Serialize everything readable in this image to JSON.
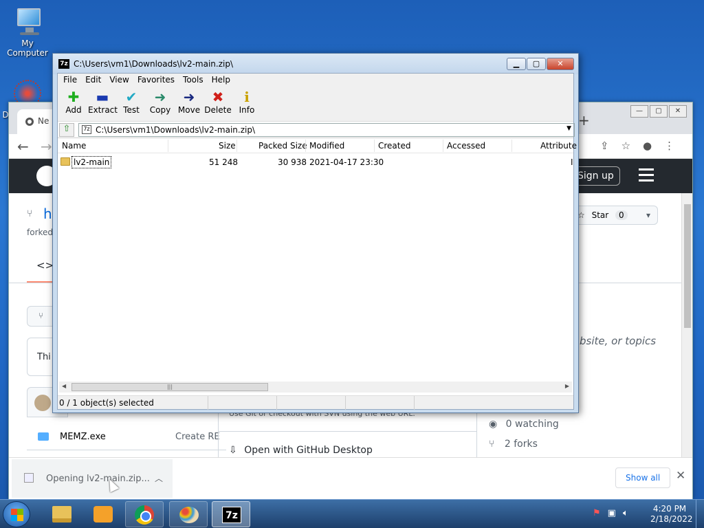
{
  "desktop": {
    "icons": [
      {
        "label": "My Computer"
      },
      {
        "label": "D"
      }
    ]
  },
  "chrome": {
    "tab_label": "Ne",
    "new_tab": "+",
    "window_buttons": [
      "—",
      "▢",
      "✕"
    ],
    "github": {
      "sign_up": "Sign up",
      "repo_prefix": "h",
      "forked_label": "forked",
      "code_tab": "<>",
      "star_label": "Star",
      "star_count": "0",
      "box_text": "Thi",
      "topics_text": "bsite, or topics",
      "svn_text": "Use Git or checkout with SVN using the web URL.",
      "open_desktop": "Open with GitHub Desktop",
      "file_name": "MEMZ.exe",
      "file_commit": "Create RE",
      "watching": "0 watching",
      "forks": "2 forks"
    },
    "download_bar": {
      "item_text": "Opening lv2-main.zip...",
      "show_all": "Show all"
    }
  },
  "zip_window": {
    "title": "C:\\Users\\vm1\\Downloads\\lv2-main.zip\\",
    "app_icon": "7z",
    "menu": [
      "File",
      "Edit",
      "View",
      "Favorites",
      "Tools",
      "Help"
    ],
    "toolbar": [
      {
        "label": "Add",
        "icon": "add-icon",
        "glyph": "✚",
        "color": "#1fae1f"
      },
      {
        "label": "Extract",
        "icon": "extract-icon",
        "glyph": "▬",
        "color": "#1a3ab0"
      },
      {
        "label": "Test",
        "icon": "test-icon",
        "glyph": "✔",
        "color": "#22a9c4"
      },
      {
        "label": "Copy",
        "icon": "copy-icon",
        "glyph": "➜",
        "color": "#2a8a6a"
      },
      {
        "label": "Move",
        "icon": "move-icon",
        "glyph": "➜",
        "color": "#1a2a80"
      },
      {
        "label": "Delete",
        "icon": "delete-icon",
        "glyph": "✖",
        "color": "#d0201a"
      },
      {
        "label": "Info",
        "icon": "info-icon",
        "glyph": "i",
        "color": "#c8a000"
      }
    ],
    "path": "C:\\Users\\vm1\\Downloads\\lv2-main.zip\\",
    "columns": [
      "Name",
      "Size",
      "Packed Size",
      "Modified",
      "Created",
      "Accessed",
      "Attribute"
    ],
    "rows": [
      {
        "name": "lv2-main",
        "size": "51 248",
        "packed": "30 938",
        "modified": "2021-04-17 23:30",
        "created": "",
        "accessed": "",
        "attr": "I"
      }
    ],
    "status": "0 / 1 object(s) selected"
  },
  "taskbar": {
    "time": "4:20 PM",
    "date": "2/18/2022",
    "seven_zip_label": "7z"
  }
}
